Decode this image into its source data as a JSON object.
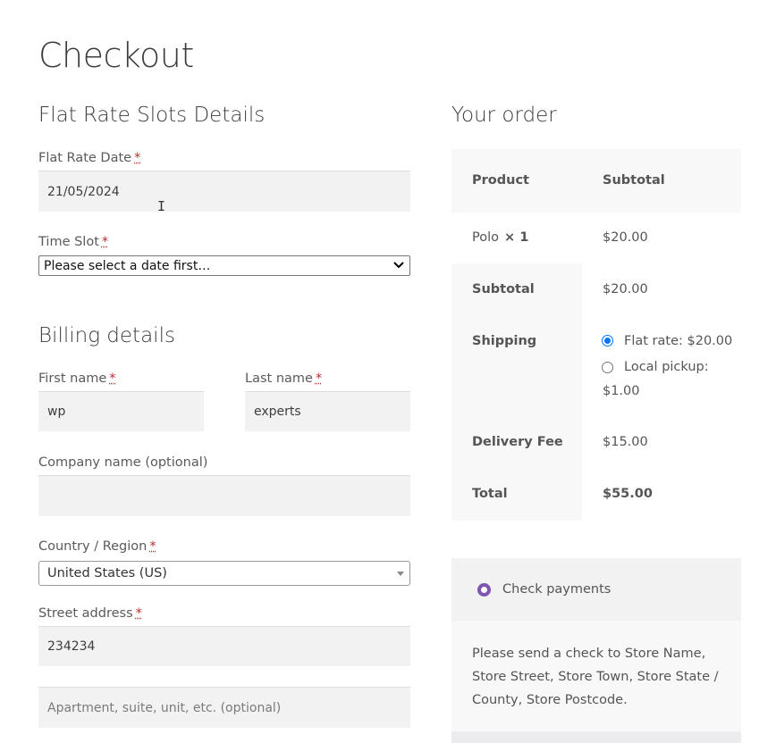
{
  "page": {
    "title": "Checkout"
  },
  "slots": {
    "title": "Flat Rate Slots Details",
    "date_label": "Flat Rate Date",
    "date_value": "21/05/2024",
    "time_label": "Time Slot",
    "time_value": "Please select a date first…"
  },
  "billing": {
    "title": "Billing details",
    "first_name_label": "First name",
    "first_name_value": "wp",
    "last_name_label": "Last name",
    "last_name_value": "experts",
    "company_label": "Company name (optional)",
    "company_value": "",
    "country_label": "Country / Region",
    "country_value": "United States (US)",
    "street_label": "Street address",
    "street_value": "234234",
    "apartment_placeholder": "Apartment, suite, unit, etc. (optional)",
    "required_mark": "*"
  },
  "order": {
    "title": "Your order",
    "col_product": "Product",
    "col_subtotal": "Subtotal",
    "item_name": "Polo",
    "item_qty": "× 1",
    "item_total": "$20.00",
    "subtotal_label": "Subtotal",
    "subtotal_value": "$20.00",
    "shipping_label": "Shipping",
    "shipping_option_1": "Flat rate: $20.00",
    "shipping_option_2_line1": "Local pickup:",
    "shipping_option_2_line2": "$1.00",
    "fee_label": "Delivery Fee",
    "fee_value": "$15.00",
    "total_label": "Total",
    "total_value": "$55.00"
  },
  "payment": {
    "method": "Check payments",
    "description": "Please send a check to Store Name, Store Street, Store Town, Store State / County, Store Postcode."
  },
  "colors": {
    "accent_purple": "#7f54b3",
    "radio_blue": "#0075ff",
    "required_red": "#b32d2e"
  }
}
